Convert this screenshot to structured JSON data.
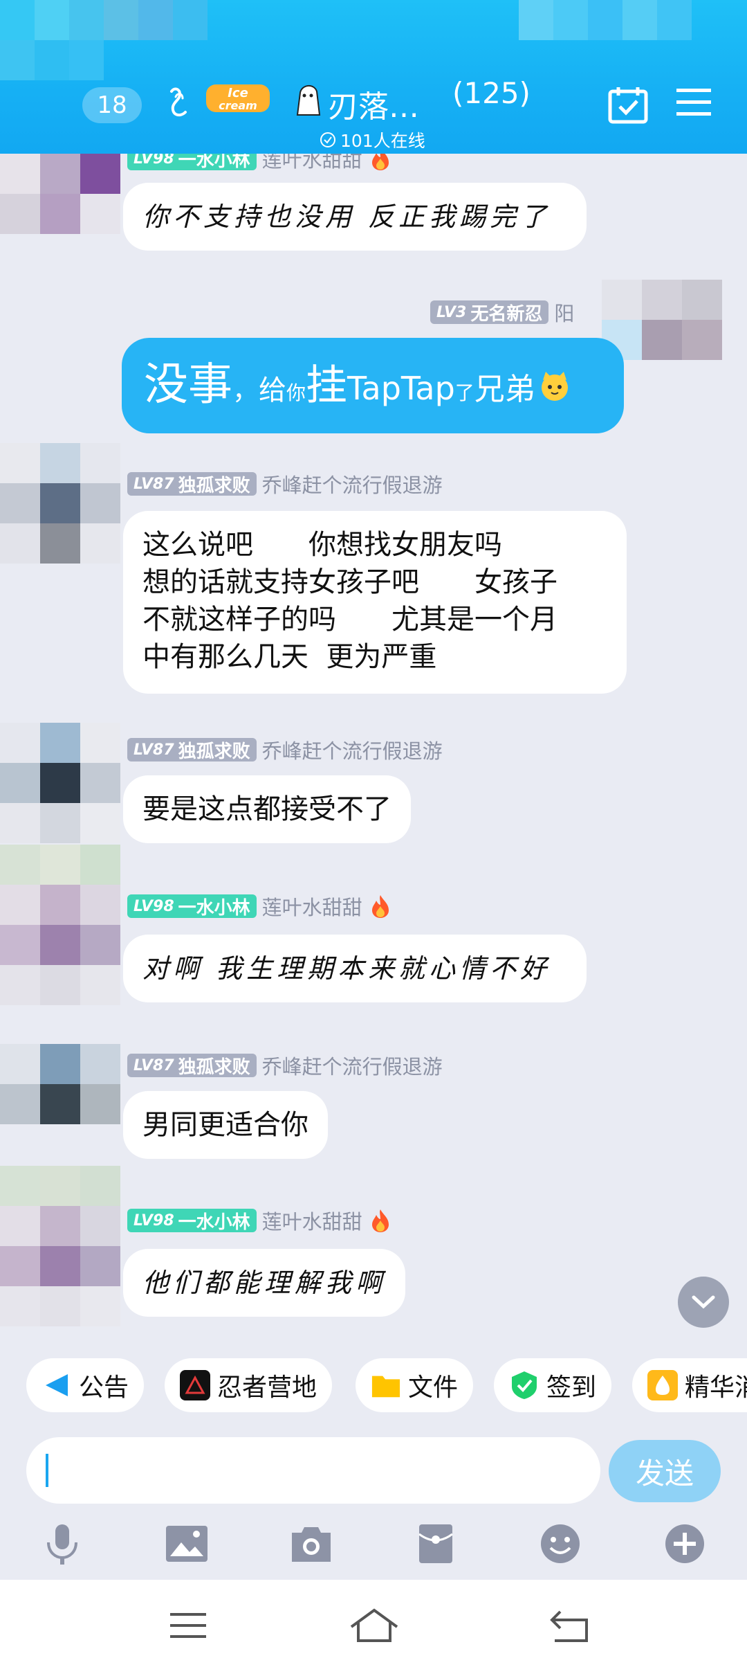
{
  "header": {
    "unread_count": "18",
    "group_name": "刃落…",
    "member_count": "(125)",
    "online_text": "101人在线",
    "logo_text": "Ice cream",
    "accent_color": "#16b0f4"
  },
  "messages": [
    {
      "level": "LV98",
      "level_title": "一水小林",
      "sender_title": "莲叶水甜甜",
      "text": "你不支持也没用 反正我踢完了"
    },
    {
      "level": "LV3",
      "level_title": "无名新忍",
      "sender_title": "阳",
      "parts": [
        "没事",
        "，",
        "给",
        "你",
        "挂",
        "TapTap",
        "了",
        "兄弟"
      ]
    },
    {
      "level": "LV87",
      "level_title": "独孤求败",
      "sender_title": "乔峰赶个流行假退游",
      "lines": [
        "这么说吧　　你想找女朋友吗",
        "想的话就支持女孩子吧　　女孩子",
        "不就这样子的吗　　尤其是一个月",
        "中有那么几天  更为严重"
      ]
    },
    {
      "level": "LV87",
      "level_title": "独孤求败",
      "sender_title": "乔峰赶个流行假退游",
      "text": "要是这点都接受不了"
    },
    {
      "level": "LV98",
      "level_title": "一水小林",
      "sender_title": "莲叶水甜甜",
      "text": "对啊 我生理期本来就心情不好"
    },
    {
      "level": "LV87",
      "level_title": "独孤求败",
      "sender_title": "乔峰赶个流行假退游",
      "text": "男同更适合你"
    },
    {
      "level": "LV98",
      "level_title": "一水小林",
      "sender_title": "莲叶水甜甜",
      "text": "他们都能理解我啊"
    }
  ],
  "shortcuts": [
    {
      "label": "公告",
      "icon": "megaphone-icon"
    },
    {
      "label": "忍者营地",
      "icon": "ninja-camp-icon"
    },
    {
      "label": "文件",
      "icon": "folder-icon"
    },
    {
      "label": "签到",
      "icon": "checkin-icon"
    },
    {
      "label": "精华消",
      "icon": "essence-icon"
    }
  ],
  "composer": {
    "send_label": "发送"
  },
  "toolbar": [
    "microphone-icon",
    "image-icon",
    "camera-icon",
    "red-packet-icon",
    "emoji-icon",
    "plus-icon"
  ],
  "navbar": [
    "menu-icon",
    "home-icon",
    "back-icon"
  ]
}
